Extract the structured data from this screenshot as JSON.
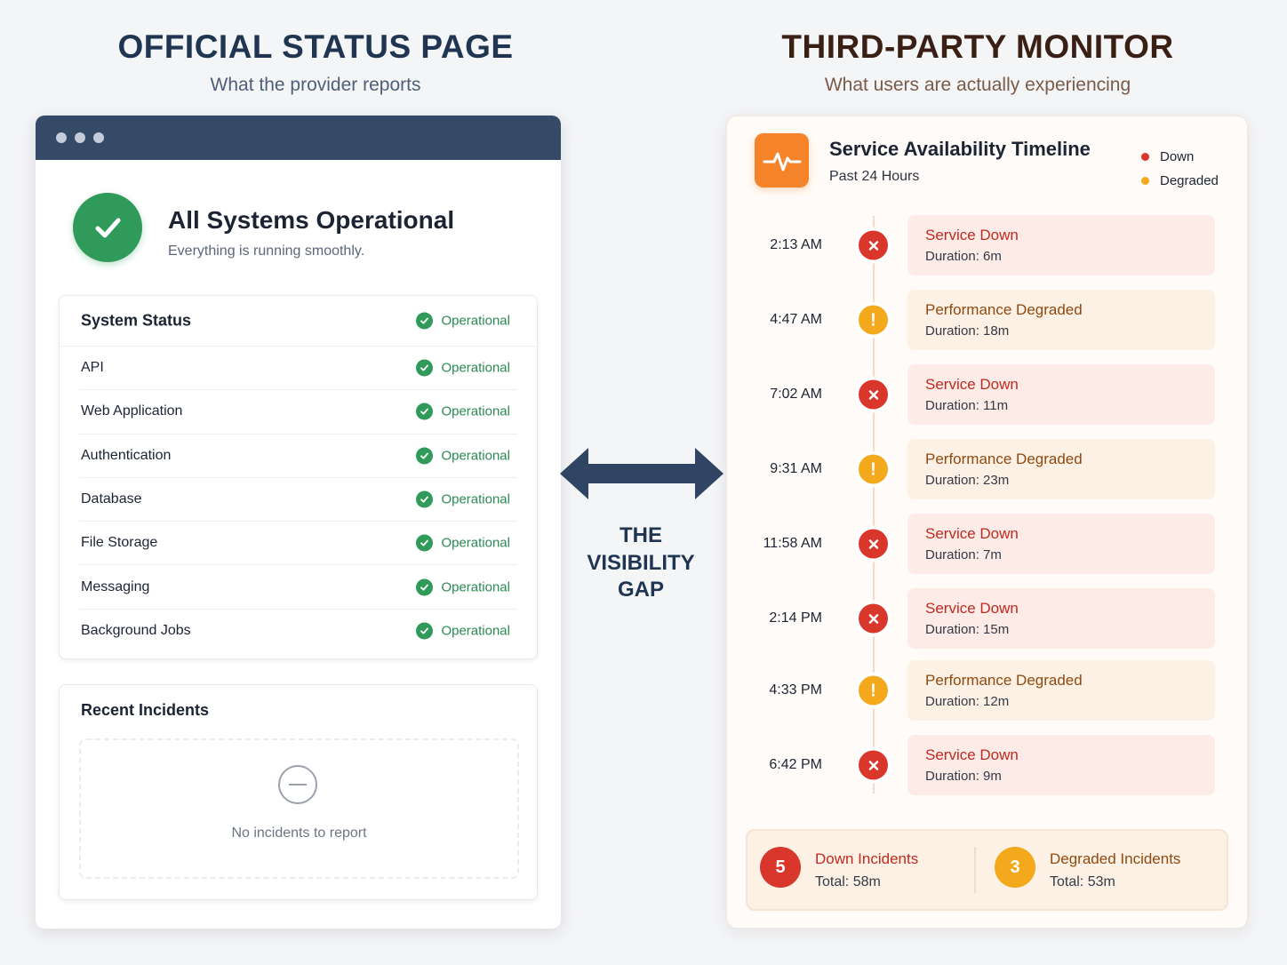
{
  "left_header": {
    "title": "OFFICIAL STATUS PAGE",
    "subtitle": "What the provider reports"
  },
  "right_header": {
    "title": "THIRD-PARTY MONITOR",
    "subtitle": "What users are actually experiencing"
  },
  "status_page": {
    "hero_title": "All Systems Operational",
    "hero_subtitle": "Everything is running smoothly.",
    "system_status": {
      "header_label": "System Status",
      "header_status": "Operational",
      "rows": [
        {
          "name": "API",
          "status": "Operational"
        },
        {
          "name": "Web Application",
          "status": "Operational"
        },
        {
          "name": "Authentication",
          "status": "Operational"
        },
        {
          "name": "Database",
          "status": "Operational"
        },
        {
          "name": "File Storage",
          "status": "Operational"
        },
        {
          "name": "Messaging",
          "status": "Operational"
        },
        {
          "name": "Background Jobs",
          "status": "Operational"
        }
      ]
    },
    "incidents": {
      "title": "Recent Incidents",
      "empty_text": "No incidents to report",
      "empty_icon": "minus-circle-icon"
    }
  },
  "gap_label": {
    "line1": "THE",
    "line2": "VISIBILITY",
    "line3": "GAP"
  },
  "monitor": {
    "logo_icon": "pulse-icon",
    "title": "Service Availability Timeline",
    "subtitle": "Past 24 Hours",
    "legend": [
      {
        "label": "Down",
        "color": "#d9372b"
      },
      {
        "label": "Degraded",
        "color": "#f4a91c"
      }
    ],
    "events": [
      {
        "time": "2:13 AM",
        "type": "down",
        "label": "Service Down",
        "duration": "Duration: 6m"
      },
      {
        "time": "4:47 AM",
        "type": "degraded",
        "label": "Performance Degraded",
        "duration": "Duration: 18m"
      },
      {
        "time": "7:02 AM",
        "type": "down",
        "label": "Service Down",
        "duration": "Duration: 11m"
      },
      {
        "time": "9:31 AM",
        "type": "degraded",
        "label": "Performance Degraded",
        "duration": "Duration: 23m"
      },
      {
        "time": "11:58 AM",
        "type": "down",
        "label": "Service Down",
        "duration": "Duration: 7m"
      },
      {
        "time": "2:14 PM",
        "type": "down",
        "label": "Service Down",
        "duration": "Duration: 15m"
      },
      {
        "time": "4:33 PM",
        "type": "degraded",
        "label": "Performance Degraded",
        "duration": "Duration: 12m"
      },
      {
        "time": "6:42 PM",
        "type": "down",
        "label": "Service Down",
        "duration": "Duration: 9m"
      }
    ],
    "summary": {
      "down": {
        "count": "5",
        "label": "Down Incidents",
        "total": "Total: 58m",
        "color": "#d9372b"
      },
      "degraded": {
        "count": "3",
        "label": "Degraded Incidents",
        "total": "Total: 53m",
        "color": "#f4a91c"
      }
    }
  },
  "colors": {
    "operational": "#2f9a5a",
    "down": "#d9372b",
    "degraded": "#f4a91c",
    "window_bar": "#344a66",
    "monitor_logo": "#f5832a"
  }
}
